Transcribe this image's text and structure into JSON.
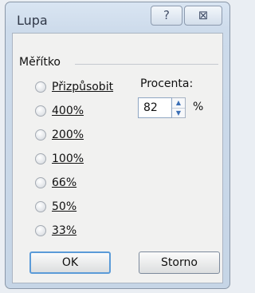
{
  "window": {
    "title": "Lupa",
    "help_glyph": "?",
    "close_glyph": "⊠"
  },
  "scale_group": {
    "label": "Měřítko",
    "options": [
      {
        "label": "Přizpůsobit",
        "selected": false
      },
      {
        "label": "400%",
        "selected": false
      },
      {
        "label": "200%",
        "selected": false
      },
      {
        "label": "100%",
        "selected": false
      },
      {
        "label": "66%",
        "selected": false
      },
      {
        "label": "50%",
        "selected": false
      },
      {
        "label": "33%",
        "selected": false
      }
    ],
    "percent_label": "Procenta:",
    "percent_value": "82",
    "percent_sign": "%"
  },
  "buttons": {
    "ok": "OK",
    "cancel": "Storno"
  },
  "icons": {
    "help": "question-mark-icon",
    "close": "close-icon",
    "spin_up": "spin-up-arrow-icon",
    "spin_down": "spin-down-arrow-icon",
    "radio": "radio-circle-icon"
  }
}
